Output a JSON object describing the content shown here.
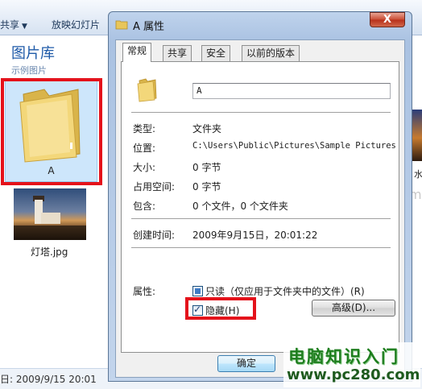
{
  "explorer": {
    "toolbar": {
      "share_menu": "共享",
      "slideshow": "放映幻灯片"
    },
    "library": {
      "title": "图片库",
      "subtitle": "示例图片"
    },
    "items": [
      {
        "label": "A",
        "type": "folder"
      },
      {
        "label": "灯塔.jpg",
        "type": "image"
      }
    ],
    "right_edge_label": "水",
    "right_edge_faded": "m",
    "status": "日: 2009/9/15 20:01"
  },
  "dialog": {
    "title": "A 属性",
    "close_label": "X",
    "tabs": [
      "常规",
      "共享",
      "安全",
      "以前的版本"
    ],
    "active_tab": "常规",
    "name_value": "A",
    "properties": [
      {
        "label": "类型:",
        "value": "文件夹"
      },
      {
        "label": "位置:",
        "value": "C:\\Users\\Public\\Pictures\\Sample Pictures"
      },
      {
        "label": "大小:",
        "value": "0 字节"
      },
      {
        "label": "占用空间:",
        "value": "0 字节"
      },
      {
        "label": "包含:",
        "value": "0 个文件，0 个文件夹"
      }
    ],
    "created": {
      "label": "创建时间:",
      "value": "2009年9月15日，20:01:22"
    },
    "attributes": {
      "label": "属性:",
      "readonly": {
        "label": "只读（仅应用于文件夹中的文件）(R)",
        "state": "indeterminate"
      },
      "hidden": {
        "label": "隐藏(H)",
        "state": "checked"
      },
      "advanced_button": "高级(D)..."
    },
    "ok_button": "确定"
  },
  "watermark": {
    "line1": "电脑知识入门",
    "line2": "www.pc280.com"
  },
  "colors": {
    "highlight": "#e4121b",
    "library_title": "#1e5aa8",
    "watermark_green": "#1e7d1e"
  }
}
